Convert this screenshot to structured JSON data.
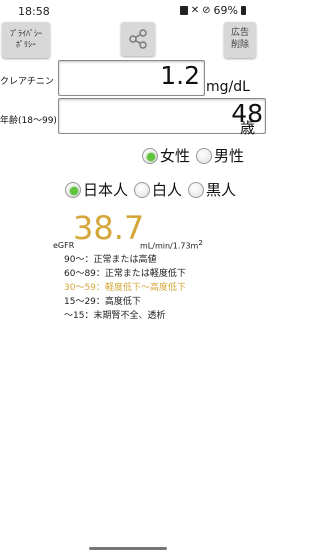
{
  "status": {
    "time": "18:58",
    "battery": "69%"
  },
  "toolbar": {
    "privacy_line1": "ﾌﾟﾗｲﾊﾞｼｰ",
    "privacy_line2": "ﾎﾟﾘｼｰ",
    "share_icon": "share-icon",
    "ad_line1": "広告",
    "ad_line2": "削除"
  },
  "creatinine": {
    "label": "クレアチニン",
    "value": "1.2",
    "unit": "mg/dL"
  },
  "age": {
    "label": "年齢(18〜99)",
    "value": "48",
    "unit": "歳"
  },
  "sex": {
    "options": [
      "女性",
      "男性"
    ],
    "selected": "女性"
  },
  "race": {
    "options": [
      "日本人",
      "白人",
      "黒人"
    ],
    "selected": "日本人"
  },
  "result": {
    "label": "eGFR",
    "value": "38.7",
    "unit_text": "mL/min/1.73m",
    "unit_sup": "2",
    "highlight_color": "#d4a73a",
    "ranges": [
      "90〜：正常または高値",
      "60〜89：正常または軽度低下",
      "30〜59：軽度低下〜高度低下",
      "15〜29：高度低下",
      "〜15：末期腎不全、透析"
    ]
  }
}
